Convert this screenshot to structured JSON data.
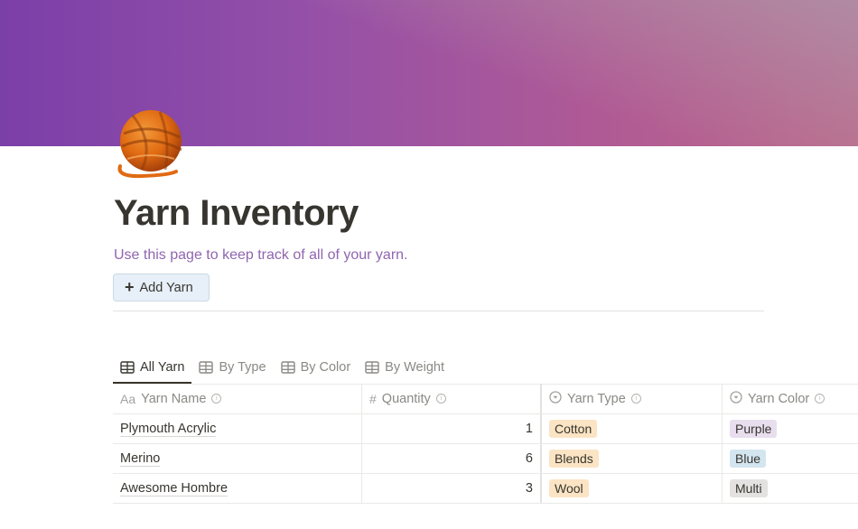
{
  "page": {
    "icon": "yarn-ball",
    "title": "Yarn Inventory",
    "description": "Use this page to keep track of all of your yarn.",
    "add_button": {
      "icon": "plus-icon",
      "label": "Add Yarn"
    }
  },
  "views": [
    {
      "label": "All Yarn",
      "icon": "table-icon",
      "active": true
    },
    {
      "label": "By Type",
      "icon": "table-icon",
      "active": false
    },
    {
      "label": "By Color",
      "icon": "table-icon",
      "active": false
    },
    {
      "label": "By Weight",
      "icon": "table-icon",
      "active": false
    }
  ],
  "table": {
    "columns": [
      {
        "label": "Yarn Name",
        "icon": "Aa",
        "type": "title"
      },
      {
        "label": "Quantity",
        "icon": "#",
        "type": "number"
      },
      {
        "label": "Yarn Type",
        "icon": "select-icon",
        "type": "select"
      },
      {
        "label": "Yarn Color",
        "icon": "select-icon",
        "type": "select"
      }
    ],
    "rows": [
      {
        "name": "Plymouth Acrylic",
        "quantity": "1",
        "type": "Cotton",
        "color": "Purple"
      },
      {
        "name": "Merino",
        "quantity": "6",
        "type": "Blends",
        "color": "Blue"
      },
      {
        "name": "Awesome Hombre",
        "quantity": "3",
        "type": "Wool",
        "color": "Multi"
      }
    ]
  },
  "tag_colors": {
    "Cotton": "#fbe4c4",
    "Blends": "#fbe4c4",
    "Wool": "#fbe4c4",
    "Purple": "#e8deee",
    "Blue": "#d3e5ef",
    "Multi": "#e3e2e0"
  }
}
